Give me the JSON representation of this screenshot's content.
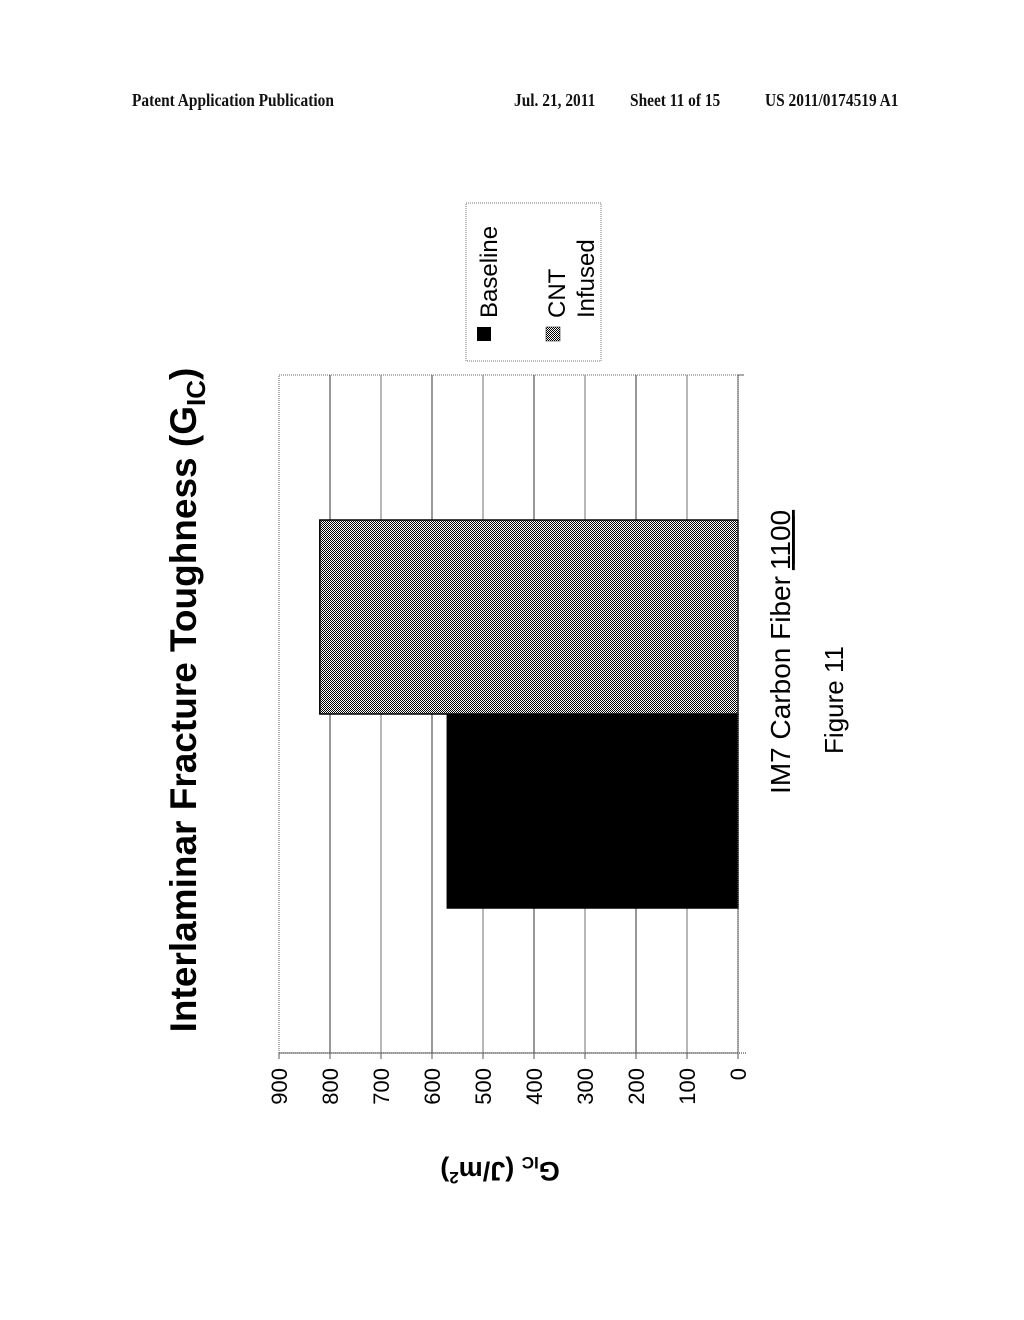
{
  "header": {
    "publication": "Patent Application Publication",
    "date": "Jul. 21, 2011",
    "sheet": "Sheet 11 of 15",
    "number": "US 2011/0174519 A1"
  },
  "figure": {
    "caption": "Figure 11",
    "reference_numeral": "1100"
  },
  "chart_data": {
    "type": "bar",
    "orientation": "vertical bars (page rotated 90° clockwise)",
    "title": "Interlaminar Fracture Toughness (G",
    "title_subscript": "IC",
    "title_suffix": ")",
    "xlabel": "IM7 Carbon Fiber",
    "ylabel_main": "G",
    "ylabel_subscript": "IC",
    "ylabel_units": " (J/m",
    "ylabel_superscript": "2",
    "ylabel_close": ")",
    "categories": [
      "IM7 Carbon Fiber"
    ],
    "series": [
      {
        "name": "Baseline",
        "values": [
          570
        ],
        "color": "#000000",
        "pattern": "solid"
      },
      {
        "name": "CNT Infused",
        "name_lines": [
          "CNT",
          "Infused"
        ],
        "values": [
          820
        ],
        "color": "#8a8a8a",
        "pattern": "checker"
      }
    ],
    "ylim": [
      0,
      900
    ],
    "yticks": [
      0,
      100,
      200,
      300,
      400,
      500,
      600,
      700,
      800,
      900
    ],
    "ytick_labels": [
      "0",
      "100",
      "200",
      "300",
      "400",
      "500",
      "600",
      "700",
      "800",
      "900"
    ],
    "grid": true,
    "legend_position": "right"
  }
}
